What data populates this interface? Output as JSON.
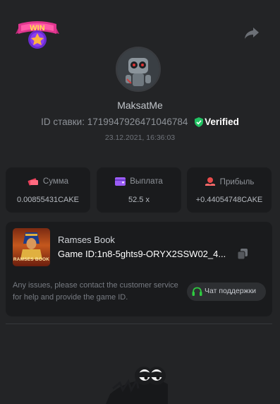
{
  "header": {
    "badge_text": "WIN",
    "share_icon": "share-icon"
  },
  "profile": {
    "username": "MaksatMe",
    "bet_id_label": "ID ставки: 1719947926471046784",
    "verified_label": "Verified",
    "timestamp": "23.12.2021, 16:36:03"
  },
  "stats": [
    {
      "label": "Сумма",
      "value": "0.00855431CAKE",
      "icon": "money-icon",
      "color": "#e8405a"
    },
    {
      "label": "Выплата",
      "value": "52.5 x",
      "icon": "wallet-icon",
      "color": "#9b5cf6"
    },
    {
      "label": "Прибыль",
      "value": "+0.44054748CAKE",
      "icon": "profit-icon",
      "color": "#e84a4a"
    }
  ],
  "game": {
    "name": "Ramses Book",
    "thumb_label": "RAMSES BOOK",
    "game_id": "Game ID:1n8-5ghts9-ORYX2SSW02_4...",
    "notice": "Any issues, please contact the customer service for help and provide the game ID.",
    "support_label": "Чат поддержки"
  },
  "colors": {
    "background": "#232426",
    "card": "#1a1b1d",
    "verified_green": "#21c262",
    "support_icon": "#2ecc40"
  }
}
